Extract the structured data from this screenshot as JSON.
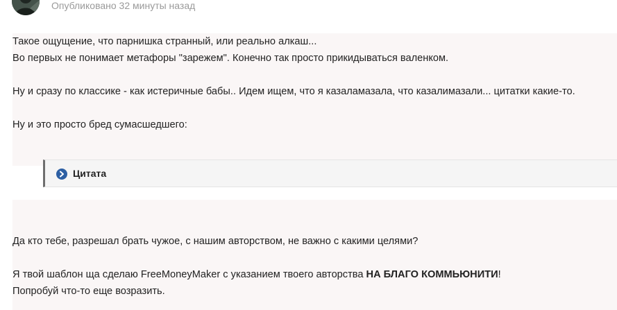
{
  "post": {
    "published": "Опубликовано 32 минуты назад",
    "lines_top": [
      "Такое ощущение, что парнишка странный, или реально алкаш...",
      "Во первых не понимает метафоры \"зарежем\". Конечно так просто прикидываться валенком.",
      "Ну и сразу по классике - как истеричные бабы.. Идем ищем, что я казаламазала, что казалимазали... цитатки какие-то.",
      "Ну и это просто бред сумасшедшего:"
    ],
    "quote_label": "Цитата",
    "lines_bottom": {
      "line1": "Да кто тебе, разрешал брать чужое, с нашим авторством, не важно с какими целями?",
      "line2_prefix": "Я твой шаблон ща сделаю FreeMoneyMaker с указанием твоего авторства ",
      "line2_bold": "НА БЛАГО КОММЬЮНИТИ",
      "line2_suffix": "!",
      "line3": "Попробуй что-то еще возразить."
    }
  },
  "colors": {
    "meta_text": "#9a9a9a",
    "body_text": "#222222",
    "post_bg": "#faf6f6",
    "quote_border": "#6e6e6e",
    "quote_icon": "#2d5fa3"
  },
  "icons": {
    "avatar": "avatar",
    "quote_icon": "chevron-right-circle-icon"
  }
}
